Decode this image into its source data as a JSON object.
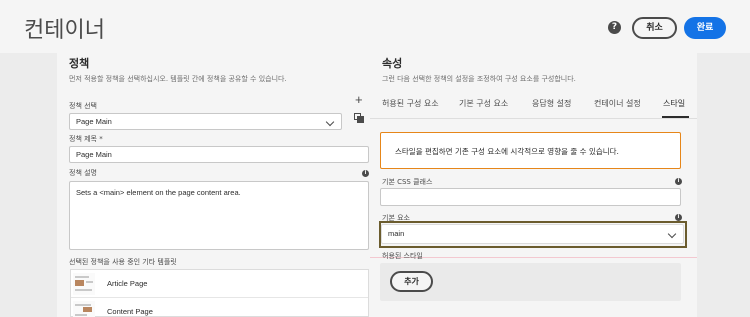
{
  "header": {
    "title": "컨테이너",
    "help_icon": "?",
    "cancel_label": "취소",
    "done_label": "완료"
  },
  "policy": {
    "title": "정책",
    "description": "먼저 적용할 정책을 선택하십시오. 템플릿 간에 정책을 공유할 수 있습니다.",
    "select_label": "정책 선택",
    "select_value": "Page Main",
    "policy_title_label": "정책 제목 *",
    "policy_title_value": "Page Main",
    "policy_desc_label": "정책 설명",
    "policy_desc_value": "Sets a <main> element on the page content area.",
    "templates_label": "선택된 정책을 사용 중인 기타 템플릿",
    "templates": [
      {
        "name": "Article Page"
      },
      {
        "name": "Content Page"
      }
    ]
  },
  "properties": {
    "title": "속성",
    "description": "그런 다음 선택한 정책의 설정을 조정하여 구성 요소를 구성합니다.",
    "tabs": [
      {
        "label": "허용된 구성 요소"
      },
      {
        "label": "기본 구성 요소"
      },
      {
        "label": "응답형 설정"
      },
      {
        "label": "컨테이너 설정"
      },
      {
        "label": "스타일"
      }
    ],
    "active_tab": "스타일",
    "alert_text": "스타일을 편집하면 기존 구성 요소에 시각적으로 영향을 줄 수 있습니다.",
    "css_class_label": "기본 CSS 클래스",
    "css_class_value": "",
    "element_label": "기본 요소",
    "element_value": "main",
    "allowed_styles_label": "허용된 스타일",
    "add_label": "추가"
  },
  "colors": {
    "accent": "#1473e6",
    "alert_border": "#e68619",
    "highlight_border": "#6b5c2e"
  }
}
